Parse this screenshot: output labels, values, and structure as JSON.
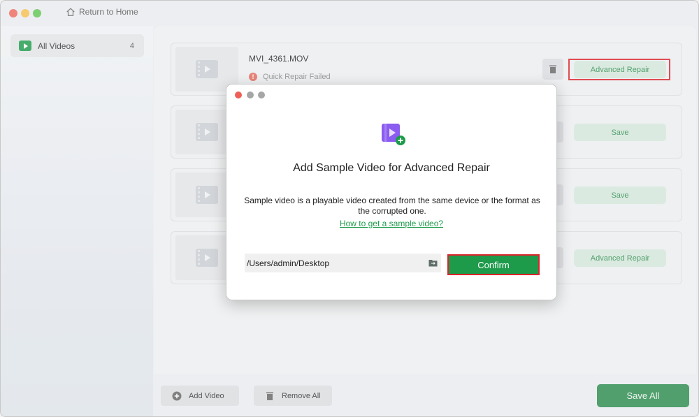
{
  "titlebar": {
    "home_label": "Return to Home"
  },
  "sidebar": {
    "items": [
      {
        "label": "All Videos",
        "count": "4",
        "icon": "play-icon"
      }
    ]
  },
  "cards": [
    {
      "file_name": "MVI_4361.MOV",
      "status": "Quick Repair Failed",
      "action": "Advanced Repair"
    },
    {
      "file_name": "",
      "status": "",
      "action": "Save"
    },
    {
      "file_name": "",
      "status": "",
      "action": "Save"
    },
    {
      "file_name": "",
      "status": "",
      "action": "Advanced Repair"
    }
  ],
  "footer": {
    "add_label": "Add Video",
    "remove_label": "Remove All",
    "save_all_label": "Save All"
  },
  "modal": {
    "title": "Add Sample Video for Advanced Repair",
    "description": "Sample video is a playable video created from the same device or the format as the corrupted one.",
    "link": "How to get a sample video?",
    "path_value": "/Users/admin/Desktop",
    "confirm_label": "Confirm"
  },
  "colors": {
    "accent_green": "#1e9a4b",
    "highlight_red": "#d9252b"
  }
}
